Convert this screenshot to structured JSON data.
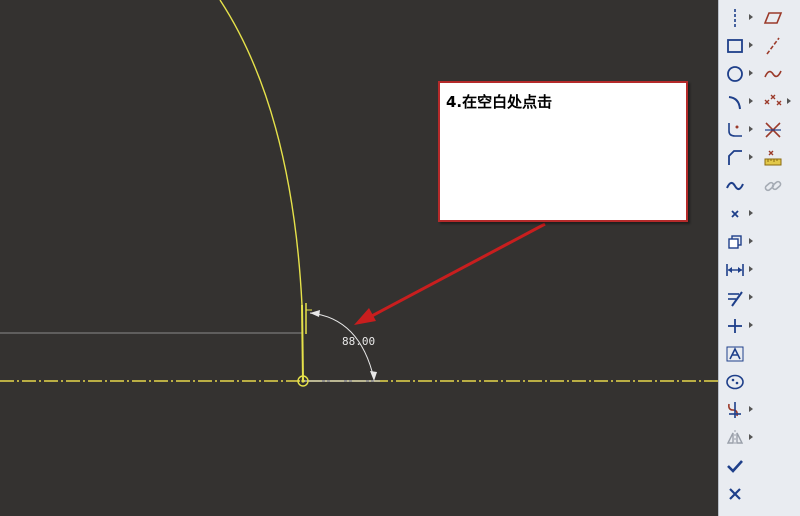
{
  "callout": {
    "text": "4.在空白处点击"
  },
  "dimension": {
    "value": "88.00"
  },
  "colors": {
    "canvas_bg": "#343230",
    "sketch_line": "#e6e24a",
    "centerline": "#e6d84a",
    "callout_border": "#b52a2a",
    "arrow": "#c81e1e",
    "toolbar_bg": "#e9ecf1",
    "icon_blue": "#1e3f8a",
    "icon_red": "#9b3a2a"
  },
  "toolbar": {
    "col1": [
      {
        "icon": "centerline-icon",
        "has_menu": true
      },
      {
        "icon": "rectangle-icon",
        "has_menu": true
      },
      {
        "icon": "circle-icon",
        "has_menu": true
      },
      {
        "icon": "arc-icon",
        "has_menu": true
      },
      {
        "icon": "fillet-icon",
        "has_menu": true
      },
      {
        "icon": "chamfer-icon",
        "has_menu": true
      },
      {
        "icon": "spline-icon",
        "has_menu": false
      },
      {
        "icon": "point-icon",
        "has_menu": true
      },
      {
        "icon": "offset-icon",
        "has_menu": true
      },
      {
        "icon": "dimension-icon",
        "has_menu": true
      },
      {
        "icon": "modify-icon",
        "has_menu": true
      },
      {
        "icon": "constraint-icon",
        "has_menu": true
      },
      {
        "icon": "text-icon",
        "has_menu": false
      },
      {
        "icon": "palette-icon",
        "has_menu": false
      },
      {
        "icon": "trim-icon",
        "has_menu": true
      },
      {
        "icon": "mirror-icon",
        "has_menu": true
      },
      {
        "icon": "checkmark-icon",
        "has_menu": false
      },
      {
        "icon": "cancel-icon",
        "has_menu": false
      }
    ],
    "col2": [
      {
        "icon": "parallelogram-icon",
        "has_menu": false
      },
      {
        "icon": "construction-line-icon",
        "has_menu": false
      },
      {
        "icon": "construction-spline-icon",
        "has_menu": false
      },
      {
        "icon": "construction-points-icon",
        "has_menu": true
      },
      {
        "icon": "intersect-icon",
        "has_menu": false
      },
      {
        "icon": "measure-icon",
        "has_menu": false
      },
      {
        "icon": "link-icon",
        "has_menu": false
      }
    ]
  }
}
